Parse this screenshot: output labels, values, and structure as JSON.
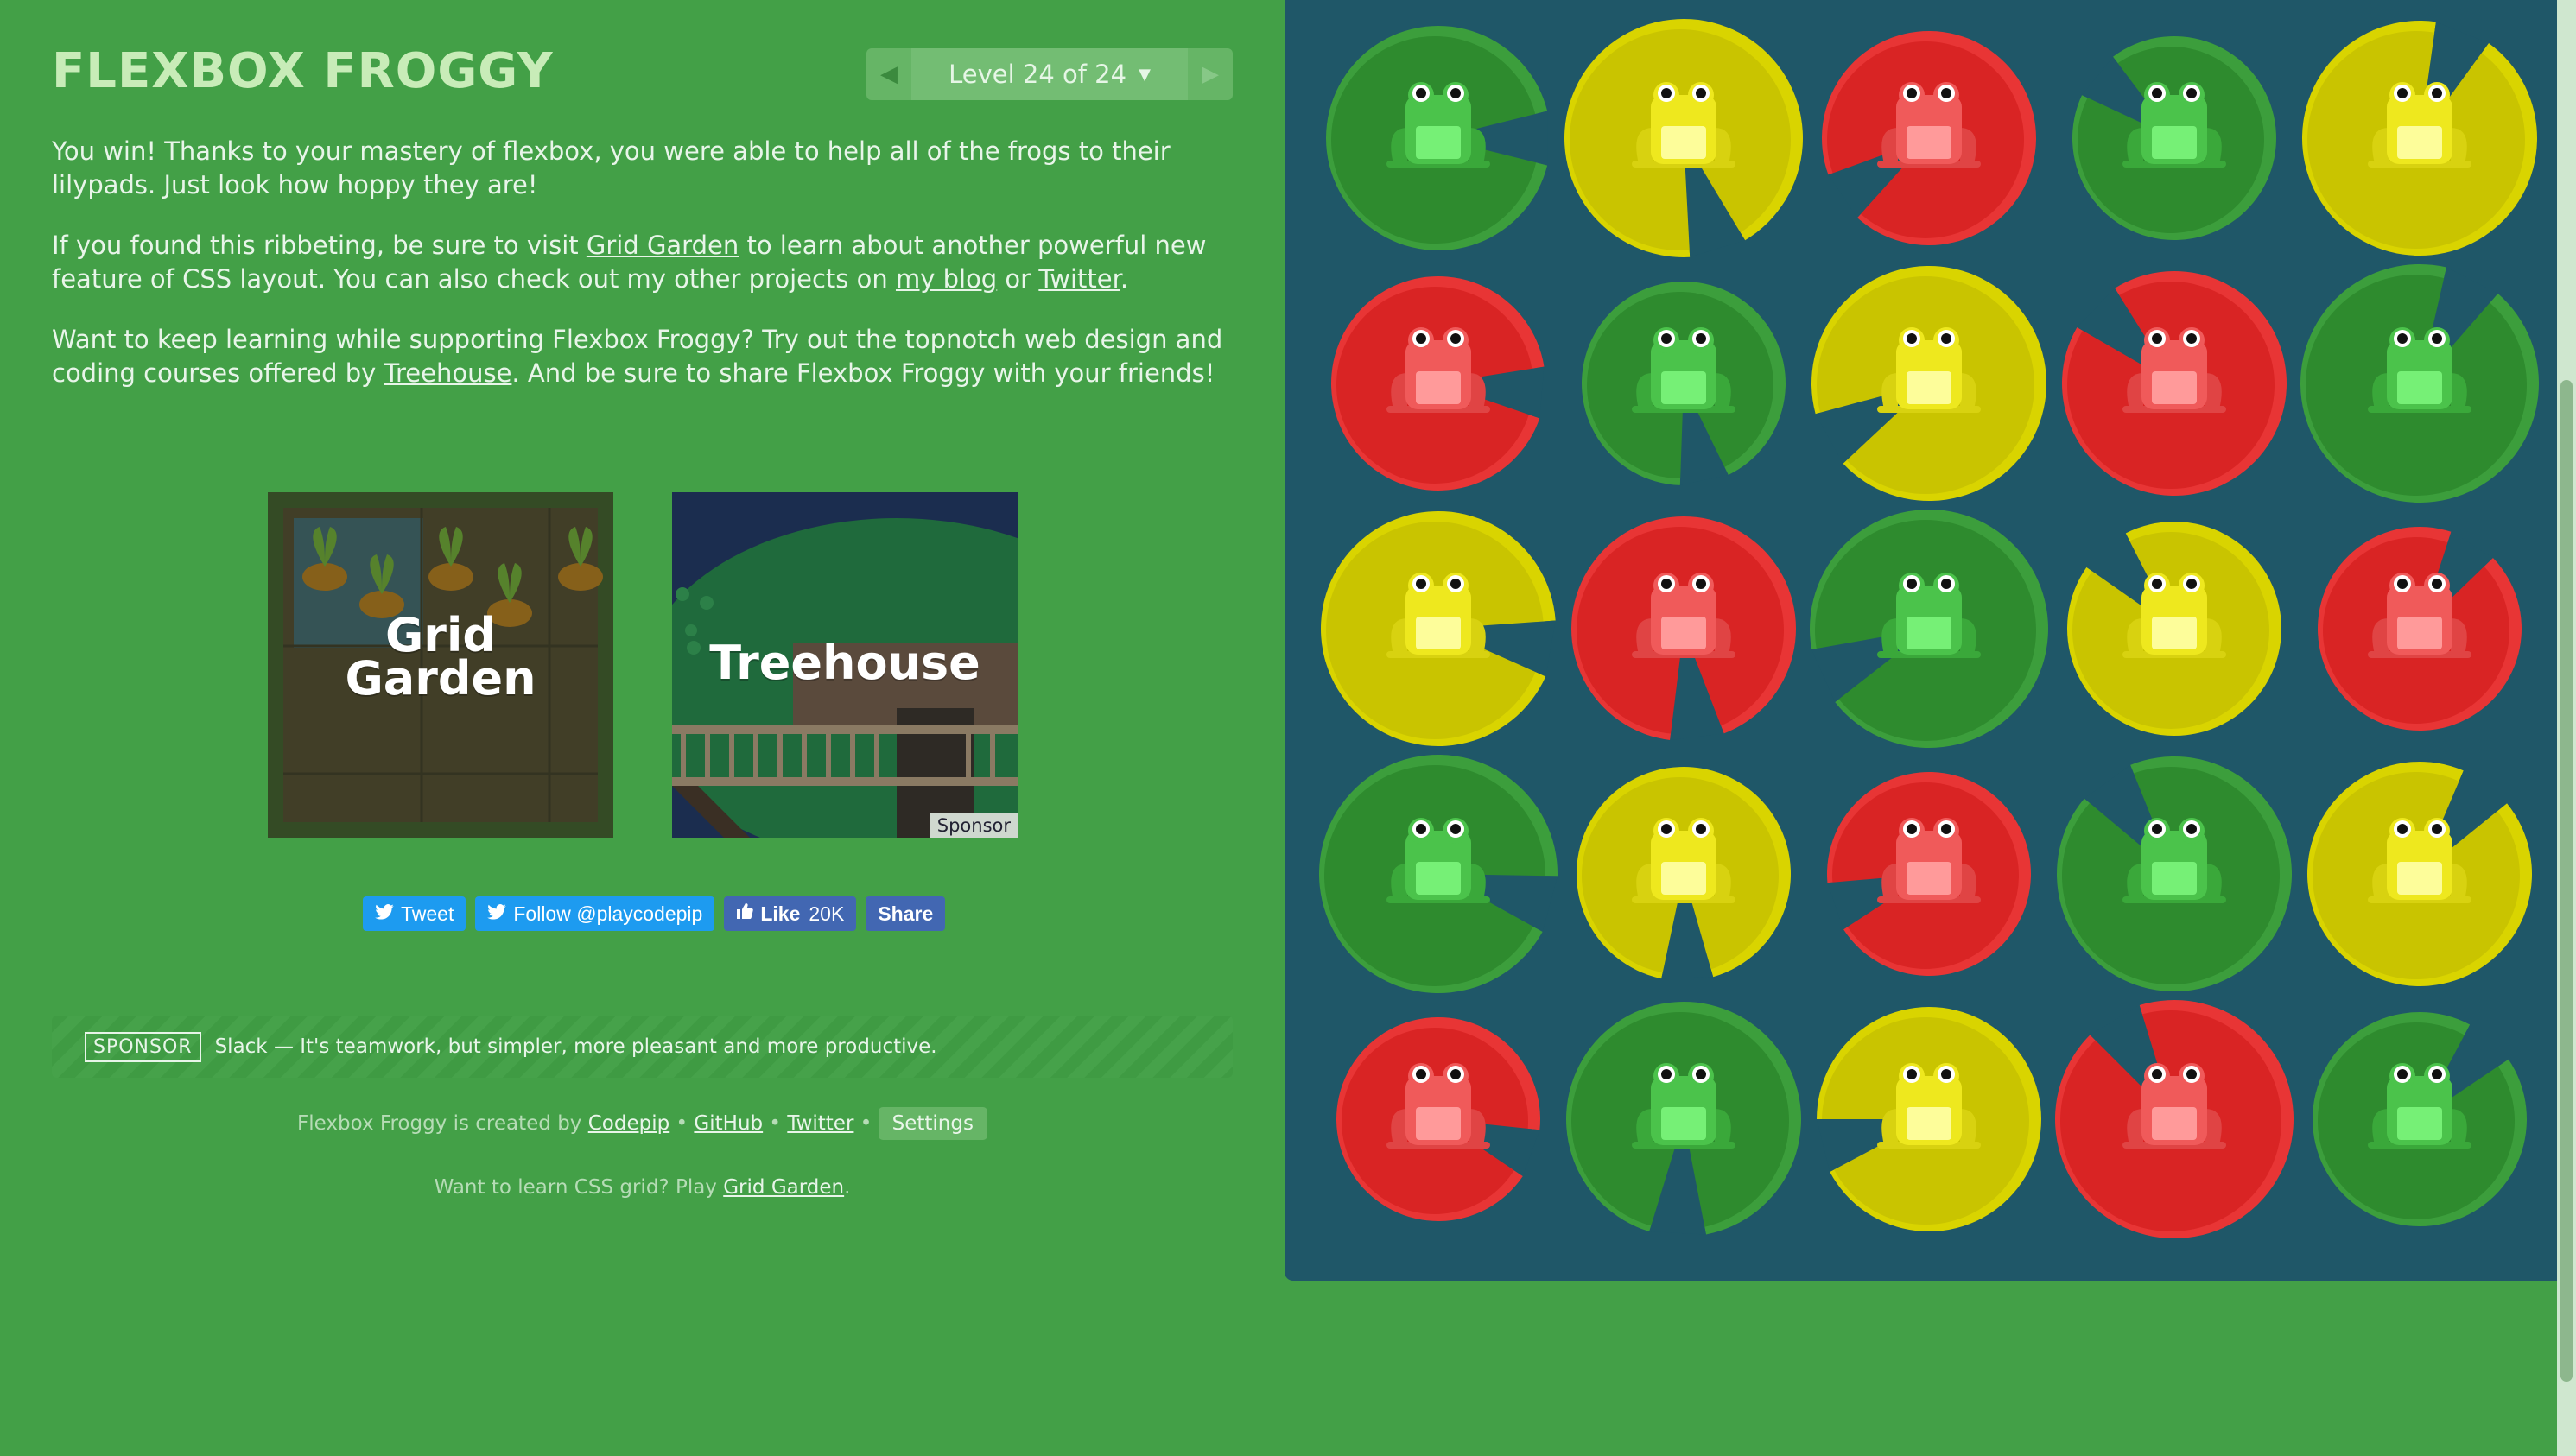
{
  "app": {
    "title": "FLEXBOX FROGGY"
  },
  "level_nav": {
    "prev": "◀",
    "indicator": "Level 24 of 24",
    "caret": "▼",
    "next": "▶"
  },
  "intro": {
    "p1": "You win! Thanks to your mastery of flexbox, you were able to help all of the frogs to their lilypads. Just look how hoppy they are!",
    "p2_a": "If you found this ribbeting, be sure to visit ",
    "p2_link1": "Grid Garden",
    "p2_b": " to learn about another powerful new feature of CSS layout. You can also check out my other projects on ",
    "p2_link2": "my blog",
    "p2_c": " or ",
    "p2_link3": "Twitter",
    "p2_d": ".",
    "p3_a": "Want to keep learning while supporting Flexbox Froggy? Try out the topnotch web design and coding courses offered by ",
    "p3_link": "Treehouse",
    "p3_b": ". And be sure to share Flexbox Froggy with your friends!"
  },
  "promos": {
    "grid_garden": {
      "line1": "Grid",
      "line2": "Garden"
    },
    "treehouse": {
      "label": "Treehouse",
      "sponsor": "Sponsor"
    }
  },
  "social": {
    "tweet": "Tweet",
    "follow": "Follow @playcodepip",
    "like": "Like",
    "like_count": "20K",
    "share": "Share"
  },
  "sponsor_bar": {
    "badge": "SPONSOR",
    "text": "Slack — It's teamwork, but simpler, more pleasant and more productive."
  },
  "credits": {
    "prefix": "Flexbox Froggy is created by ",
    "codepip": "Codepip",
    "sep": " • ",
    "github": "GitHub",
    "twitter": "Twitter",
    "settings": "Settings"
  },
  "grid_note": {
    "prefix": "Want to learn CSS grid? Play ",
    "link": "Grid Garden",
    "suffix": "."
  },
  "colors": {
    "background": "#43a047",
    "pond": "#1f5768",
    "green_pad": "#2e8b2e",
    "green_frog": "#5fd35f",
    "yellow_pad": "#c9c400",
    "yellow_frog": "#f3ee1f",
    "red_pad": "#d92424",
    "red_frog": "#ff6b6b"
  },
  "pond": {
    "rows": [
      [
        "green",
        "yellow",
        "red",
        "green",
        "yellow"
      ],
      [
        "red",
        "green",
        "yellow",
        "red",
        "green"
      ],
      [
        "yellow",
        "red",
        "green",
        "yellow",
        "red"
      ],
      [
        "green",
        "yellow",
        "red",
        "green",
        "yellow"
      ],
      [
        "red",
        "green",
        "yellow",
        "red",
        "green"
      ]
    ]
  }
}
